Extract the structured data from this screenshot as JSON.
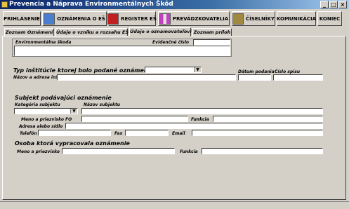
{
  "window": {
    "title": "Prevencia a Náprava Environmentálnych Škôd",
    "minimize_glyph": "_",
    "maximize_glyph": "□",
    "close_glyph": "×"
  },
  "menu": {
    "prihlasenie": "PRIHLÁSENIE",
    "oznamenia": "OZNÁMENIA O EŠ",
    "register": "REGISTER EŠ",
    "prevadzkovatelia": "PREVÁDZKOVATELIA",
    "ciselniky": "ČÍSELNÍKY",
    "komunikacia": "KOMUNIKÁCIA",
    "koniec": "KONIEC"
  },
  "tabs": {
    "zoznam": "Zoznam Oznámení",
    "udaje_vznik": "Údaje o vzniku a rozsahu EŠ",
    "udaje_oznamovatel": "Údaje o oznamovateľovi",
    "prilohy": "Zoznam príloh"
  },
  "env_skoda": {
    "label": "Environmentálna škoda",
    "evidencne_label": "Evidenčné číslo"
  },
  "institucia": {
    "title": "Typ inštitúcie ktorej bolo podané oznámenie",
    "nazov_label": "Názov a adresa inštitúcie",
    "datum_label": "Dátum podania",
    "cislo_label": "Číslo spisu"
  },
  "subjekt": {
    "title": "Subjekt podávajúci oznámenie",
    "kategoria_label": "Kategória subjektu",
    "nazov_label": "Názov subjektu",
    "meno_label": "Meno a priezvisko FO",
    "funkcia_label": "Funkcia",
    "adresa_label": "Adresa alebo sídlo",
    "telefon_label": "Telefón",
    "fax_label": "Fax",
    "email_label": "Email"
  },
  "osoba": {
    "title": "Osoba ktorá vypracovala oznámenie",
    "meno_label": "Meno a priezvisko",
    "funkcia_label": "Funkcia"
  },
  "colors": {
    "titlebar_start": "#0a246a",
    "titlebar_end": "#a6caf0",
    "face": "#d4d0c8"
  }
}
